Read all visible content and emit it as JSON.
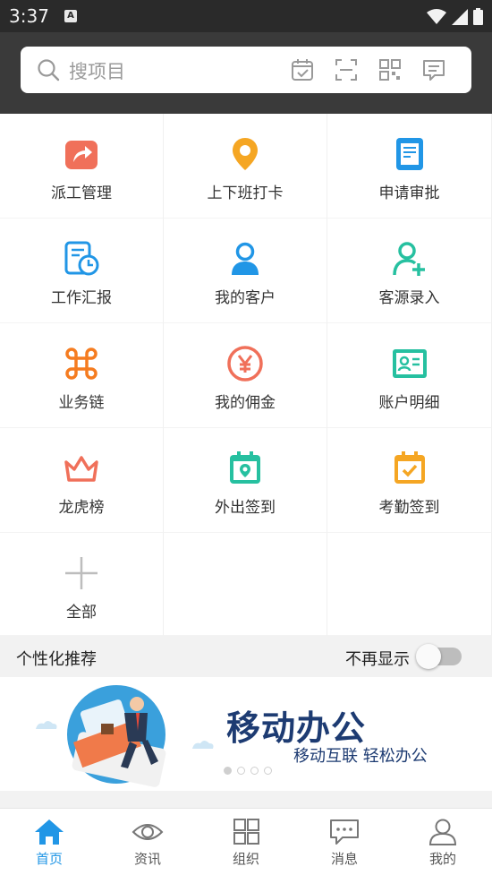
{
  "status_bar": {
    "time": "3:37",
    "notification_letter": "A"
  },
  "search": {
    "placeholder": "搜项目"
  },
  "grid": {
    "items": [
      {
        "label": "派工管理",
        "icon": "share-box-icon",
        "color": "#f0705a"
      },
      {
        "label": "上下班打卡",
        "icon": "location-pin-icon",
        "color": "#f5a623"
      },
      {
        "label": "申请审批",
        "icon": "document-icon",
        "color": "#2196e6"
      },
      {
        "label": "工作汇报",
        "icon": "report-clock-icon",
        "color": "#2196e6"
      },
      {
        "label": "我的客户",
        "icon": "person-icon",
        "color": "#2196e6"
      },
      {
        "label": "客源录入",
        "icon": "person-add-icon",
        "color": "#26c0a0"
      },
      {
        "label": "业务链",
        "icon": "command-icon",
        "color": "#f57c20"
      },
      {
        "label": "我的佣金",
        "icon": "yen-coin-icon",
        "color": "#f0705a"
      },
      {
        "label": "账户明细",
        "icon": "id-card-icon",
        "color": "#26c0a0"
      },
      {
        "label": "龙虎榜",
        "icon": "crown-icon",
        "color": "#f0705a"
      },
      {
        "label": "外出签到",
        "icon": "calendar-pin-icon",
        "color": "#26c0a0"
      },
      {
        "label": "考勤签到",
        "icon": "calendar-check-icon",
        "color": "#f5a623"
      },
      {
        "label": "全部",
        "icon": "plus-icon",
        "color": "#bdbdbd"
      }
    ]
  },
  "recommend": {
    "title": "个性化推荐",
    "hide_label": "不再显示",
    "enabled": false
  },
  "banner": {
    "title": "移动办公",
    "subtitle": "移动互联  轻松办公",
    "active_slide": 1,
    "slide_count": 4
  },
  "tabbar": {
    "items": [
      {
        "label": "首页",
        "icon": "home-icon",
        "active": true
      },
      {
        "label": "资讯",
        "icon": "eye-icon",
        "active": false
      },
      {
        "label": "组织",
        "icon": "grid-icon",
        "active": false
      },
      {
        "label": "消息",
        "icon": "chat-icon",
        "active": false
      },
      {
        "label": "我的",
        "icon": "profile-icon",
        "active": false
      }
    ]
  },
  "colors": {
    "accent": "#2196e6",
    "header_bg": "#3a3a3a",
    "banner_text": "#1d3b72"
  }
}
